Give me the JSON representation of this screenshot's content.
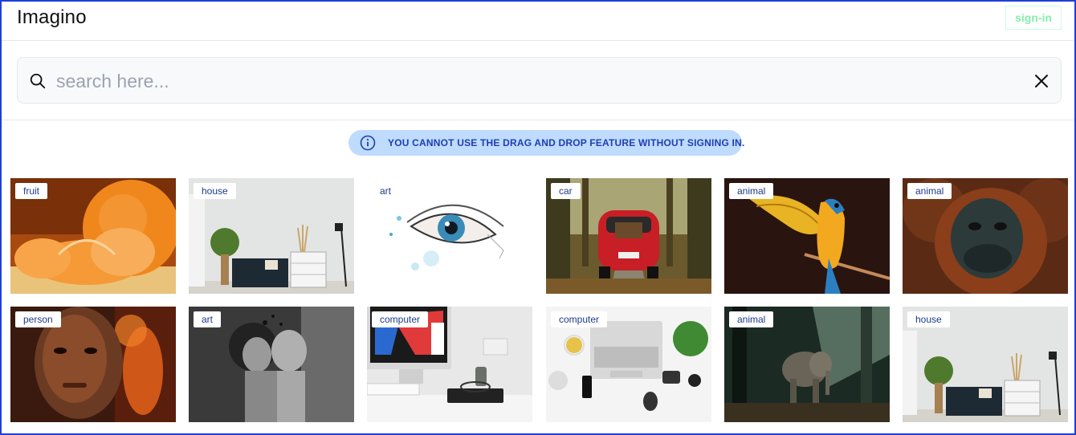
{
  "header": {
    "logo": "Imagino",
    "signin_label": "sign-in"
  },
  "search": {
    "placeholder": "search here...",
    "value": ""
  },
  "notice": {
    "text": "YOU CANNOT USE THE DRAG AND DROP FEATURE WITHOUT SIGNING IN."
  },
  "gallery": {
    "images": [
      {
        "tag": "fruit"
      },
      {
        "tag": "house"
      },
      {
        "tag": "art"
      },
      {
        "tag": "car"
      },
      {
        "tag": "animal"
      },
      {
        "tag": "animal"
      },
      {
        "tag": "person"
      },
      {
        "tag": "art"
      },
      {
        "tag": "computer"
      },
      {
        "tag": "computer"
      },
      {
        "tag": "animal"
      },
      {
        "tag": "house"
      }
    ]
  },
  "colors": {
    "accent": "#1e40af",
    "notice_bg": "#bfdbfe",
    "signin": "#86efac",
    "frame": "#1d3fd8"
  }
}
